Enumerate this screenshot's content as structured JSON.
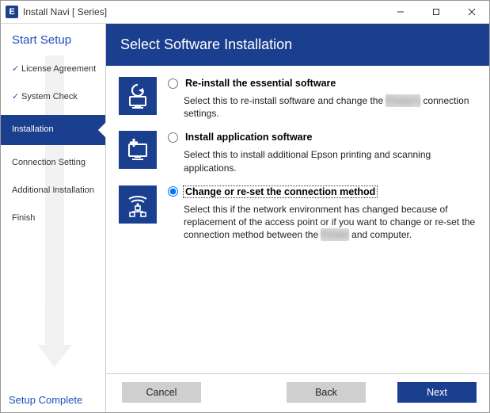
{
  "window": {
    "app_icon_letter": "E",
    "title": "Install Navi [        Series]"
  },
  "sidebar": {
    "start": "Start Setup",
    "complete": "Setup Complete",
    "steps": [
      {
        "label": "License Agreement",
        "done": true,
        "active": false
      },
      {
        "label": "System Check",
        "done": true,
        "active": false
      },
      {
        "label": "Installation",
        "done": false,
        "active": true
      },
      {
        "label": "Connection Setting",
        "done": false,
        "active": false
      },
      {
        "label": "Additional Installation",
        "done": false,
        "active": false
      },
      {
        "label": "Finish",
        "done": false,
        "active": false
      }
    ]
  },
  "header": {
    "title": "Select Software Installation"
  },
  "options": [
    {
      "id": "reinstall",
      "title": "Re-install the essential software",
      "desc_before": "Select this to re-install software and change the ",
      "desc_blur": "Printer's",
      "desc_after": " connection settings.",
      "selected": false
    },
    {
      "id": "apps",
      "title": "Install application software",
      "desc_before": "Select this to install additional Epson printing and scanning applications.",
      "desc_blur": "",
      "desc_after": "",
      "selected": false
    },
    {
      "id": "connection",
      "title": "Change or re-set the connection method",
      "desc_before": "Select this if the network environment has changed because of replacement of the access point or if you want to change or re-set the connection method between the ",
      "desc_blur": "Printer",
      "desc_after": " and computer.",
      "selected": true
    }
  ],
  "footer": {
    "cancel": "Cancel",
    "back": "Back",
    "next": "Next"
  }
}
